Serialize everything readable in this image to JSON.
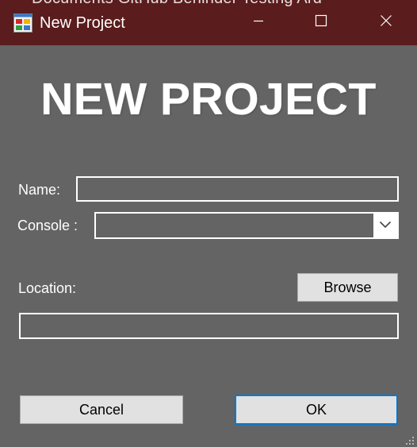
{
  "window": {
    "title": "New Project",
    "behind_text": "Documents      GitHub      Behinder Testing      Ard",
    "controls": {
      "minimize": "minimize",
      "maximize": "maximize",
      "close": "close"
    }
  },
  "heading": "NEW PROJECT",
  "form": {
    "name_label": "Name:",
    "name_value": "",
    "console_label": "Console :",
    "console_value": "",
    "location_label": "Location:",
    "browse_label": "Browse",
    "location_value": ""
  },
  "actions": {
    "cancel_label": "Cancel",
    "ok_label": "OK"
  },
  "colors": {
    "titlebar": "#5a1c1c",
    "background": "#646464",
    "button": "#e1e1e1",
    "focus_border": "#0078d7"
  }
}
